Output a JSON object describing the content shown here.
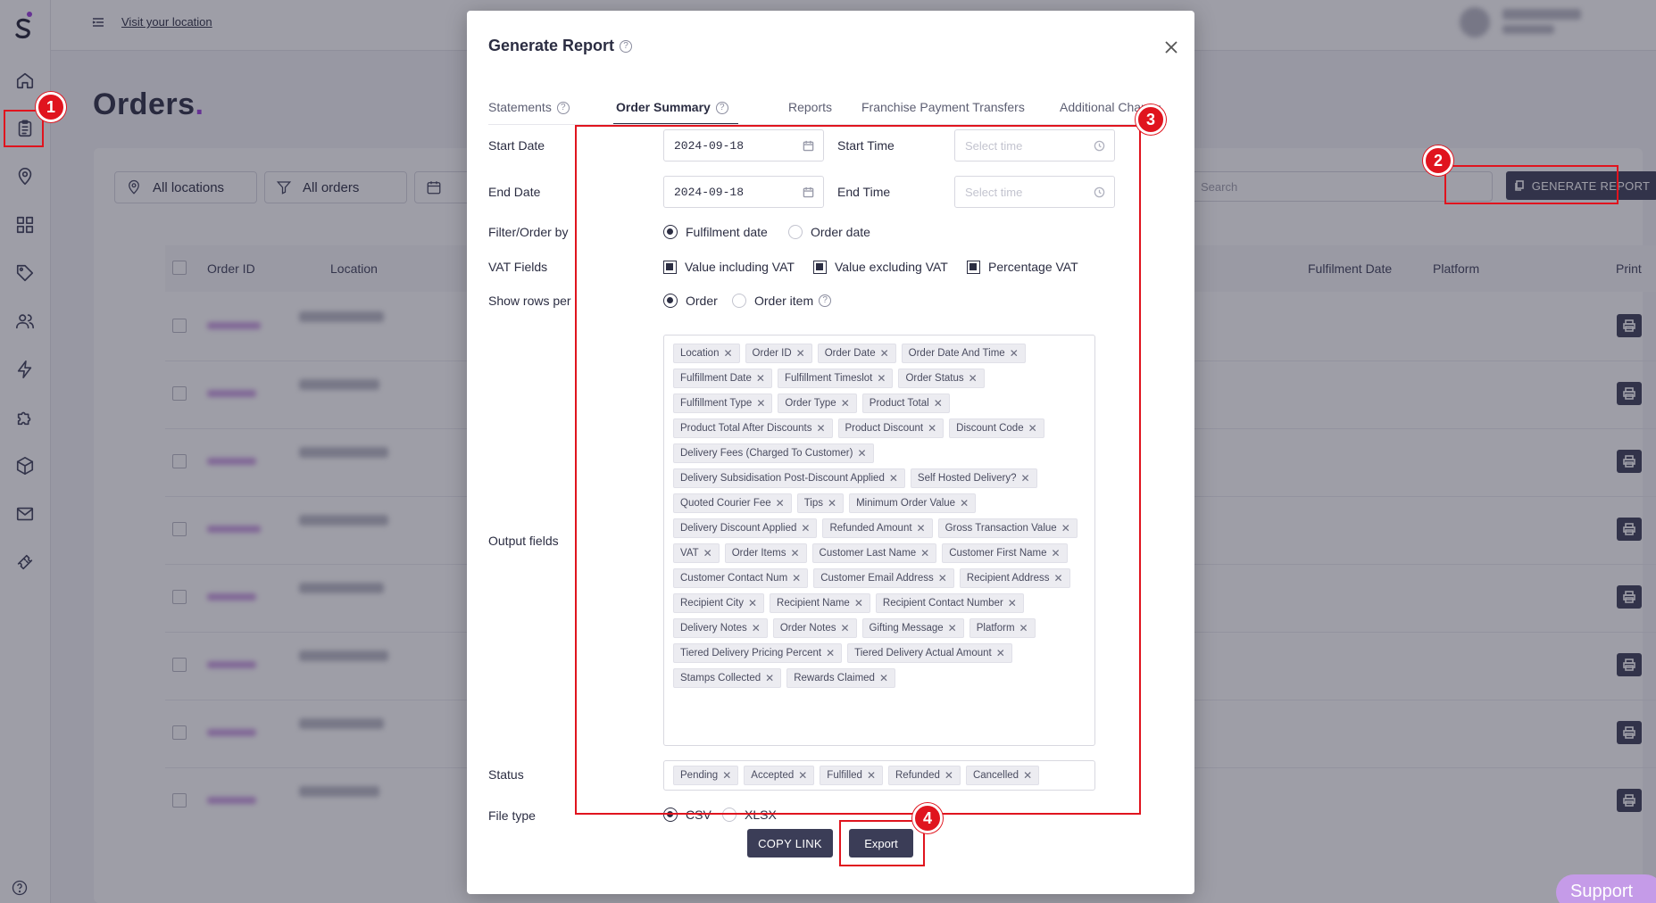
{
  "topbar": {
    "visit_link": "Visit your location"
  },
  "page": {
    "title": "Orders",
    "title_dot": "."
  },
  "filters": {
    "locations": "All locations",
    "orders": "All orders",
    "search_placeholder": "Search"
  },
  "generate_button": "GENERATE REPORT",
  "table_headers": {
    "order_id": "Order ID",
    "location": "Location",
    "fulfilment_date": "Fulfilment Date",
    "platform": "Platform",
    "print": "Print"
  },
  "modal": {
    "title": "Generate Report",
    "tabs": [
      "Statements",
      "Order Summary",
      "Reports",
      "Franchise Payment Transfers",
      "Additional Char"
    ],
    "active_tab": "Order Summary",
    "tab_more": "...",
    "labels": {
      "start_date": "Start Date",
      "end_date": "End Date",
      "start_time": "Start Time",
      "end_time": "End Time",
      "filter_order_by": "Filter/Order by",
      "vat_fields": "VAT Fields",
      "show_rows_per": "Show rows per",
      "output_fields": "Output fields",
      "status": "Status",
      "file_type": "File type"
    },
    "start_date_value": "2024-09-18",
    "end_date_value": "2024-09-18",
    "time_placeholder": "Select time",
    "filter_options": {
      "fulfilment": "Fulfilment date",
      "order": "Order date",
      "selected": "Fulfilment date"
    },
    "vat_options": {
      "including": "Value including VAT",
      "excluding": "Value excluding VAT",
      "percentage": "Percentage VAT"
    },
    "rows_options": {
      "order": "Order",
      "order_item": "Order item",
      "selected": "Order"
    },
    "output_fields": [
      "Location",
      "Order ID",
      "Order Date",
      "Order Date And Time",
      "Fulfillment Date",
      "Fulfillment Timeslot",
      "Order Status",
      "Fulfillment Type",
      "Order Type",
      "Product Total",
      "Product Total After Discounts",
      "Product Discount",
      "Discount Code",
      "Delivery Fees (Charged To Customer)",
      "Delivery Subsidisation Post-Discount Applied",
      "Self Hosted Delivery?",
      "Quoted Courier Fee",
      "Tips",
      "Minimum Order Value",
      "Delivery Discount Applied",
      "Refunded Amount",
      "Gross Transaction Value",
      "VAT",
      "Order Items",
      "Customer Last Name",
      "Customer First Name",
      "Customer Contact Num",
      "Customer Email Address",
      "Recipient Address",
      "Recipient City",
      "Recipient Name",
      "Recipient Contact Number",
      "Delivery Notes",
      "Order Notes",
      "Gifting Message",
      "Platform",
      "Tiered Delivery Pricing Percent",
      "Tiered Delivery Actual Amount",
      "Stamps Collected",
      "Rewards Claimed"
    ],
    "status_tags": [
      "Pending",
      "Accepted",
      "Fulfilled",
      "Refunded",
      "Cancelled"
    ],
    "file_type_options": {
      "csv": "CSV",
      "xlsx": "XLSX",
      "selected": "CSV"
    },
    "copy_link_button": "COPY LINK",
    "export_button": "Export"
  },
  "annotations": [
    "1",
    "2",
    "3",
    "4"
  ],
  "support": {
    "label": "Support"
  },
  "colors": {
    "accent": "#3b3d57",
    "brand_purple": "#9a3bdc",
    "annotation_red": "#e0141e"
  }
}
